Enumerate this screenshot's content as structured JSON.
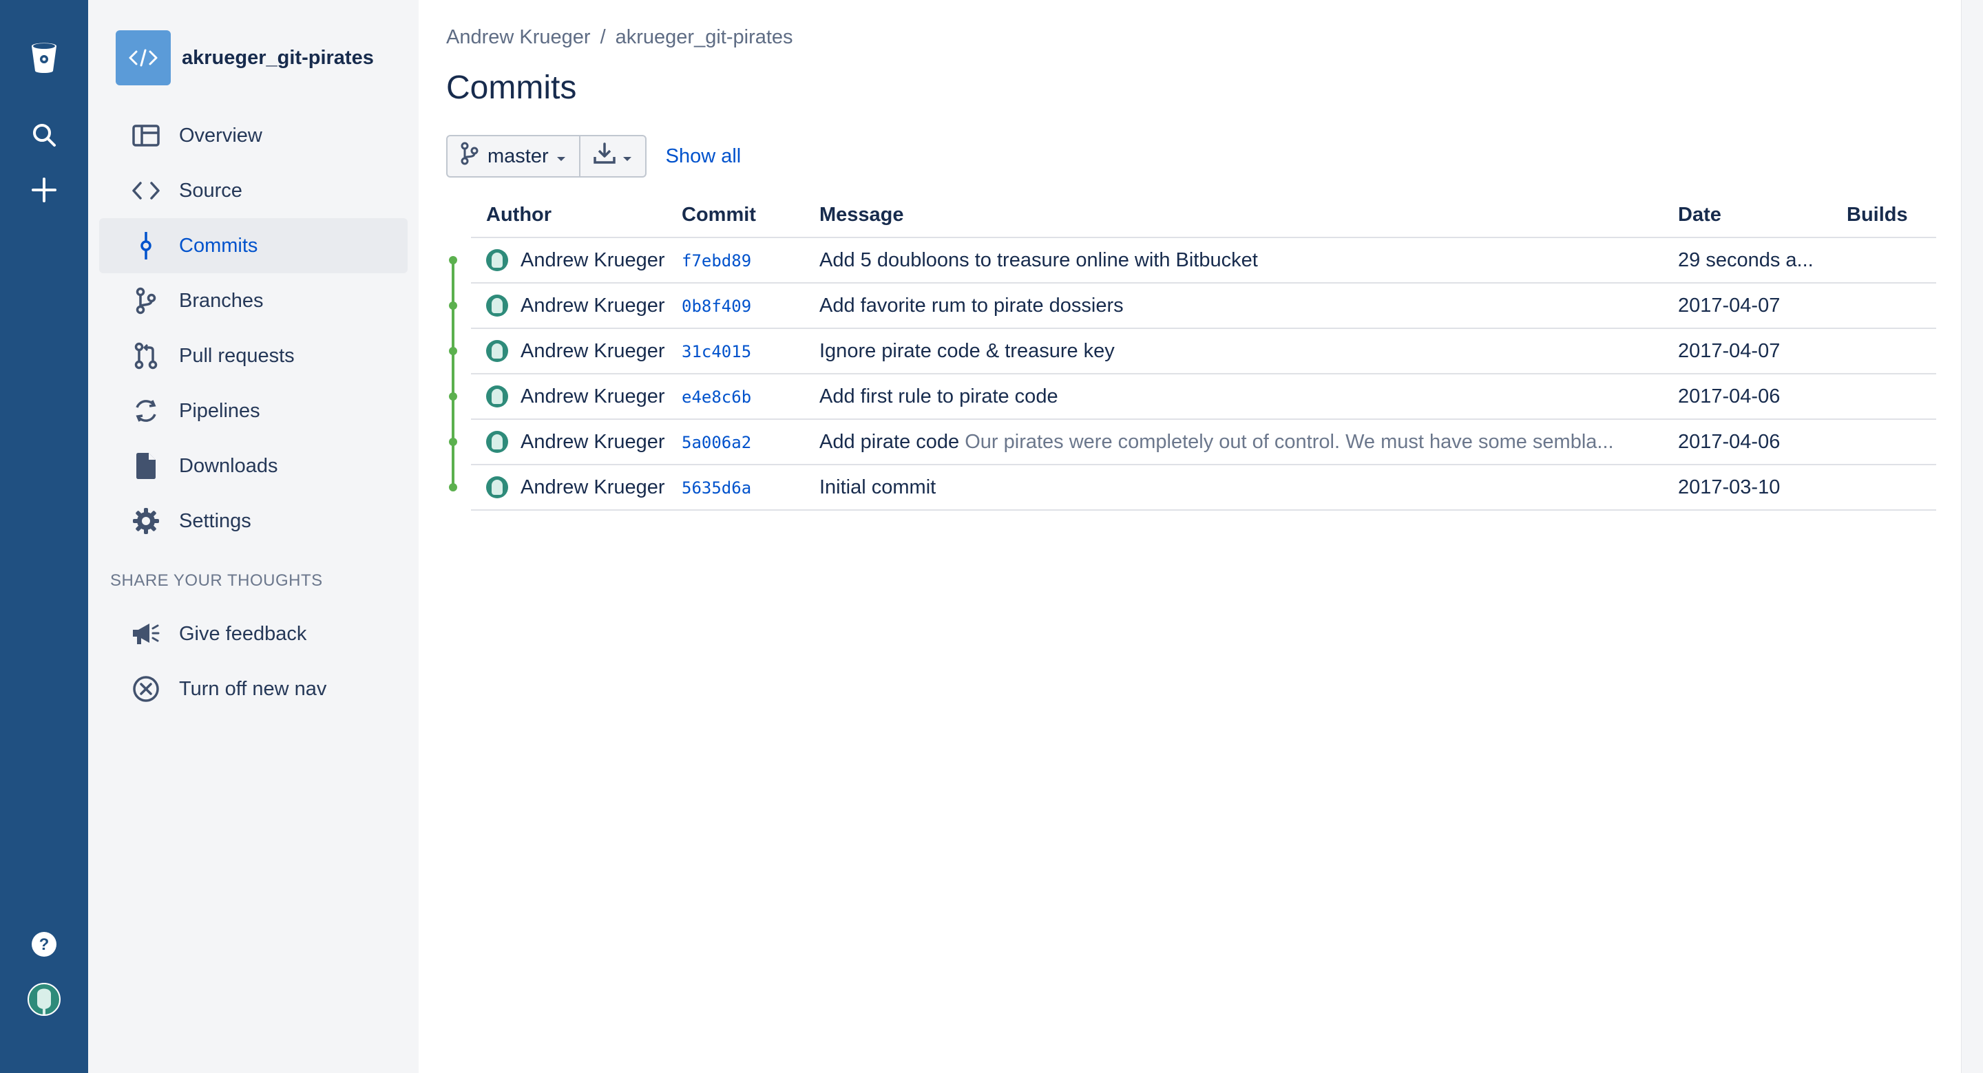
{
  "repo": {
    "name": "akrueger_git-pirates"
  },
  "sidebar": {
    "items": [
      {
        "label": "Overview",
        "icon": "overview-icon"
      },
      {
        "label": "Source",
        "icon": "code-icon"
      },
      {
        "label": "Commits",
        "icon": "commit-icon",
        "active": true
      },
      {
        "label": "Branches",
        "icon": "branch-icon"
      },
      {
        "label": "Pull requests",
        "icon": "pull-request-icon"
      },
      {
        "label": "Pipelines",
        "icon": "pipelines-icon"
      },
      {
        "label": "Downloads",
        "icon": "file-icon"
      },
      {
        "label": "Settings",
        "icon": "gear-icon"
      }
    ],
    "section_title": "SHARE YOUR THOUGHTS",
    "section_items": [
      {
        "label": "Give feedback",
        "icon": "megaphone-icon"
      },
      {
        "label": "Turn off new nav",
        "icon": "close-circle-icon"
      }
    ]
  },
  "breadcrumb": {
    "owner": "Andrew Krueger",
    "separator": "/",
    "repo": "akrueger_git-pirates"
  },
  "page": {
    "title": "Commits"
  },
  "toolbar": {
    "branch": "master",
    "show_all": "Show all"
  },
  "table": {
    "headers": {
      "author": "Author",
      "commit": "Commit",
      "message": "Message",
      "date": "Date",
      "builds": "Builds"
    },
    "rows": [
      {
        "author": "Andrew Krueger",
        "hash": "f7ebd89",
        "message": "Add 5 doubloons to treasure online with Bitbucket",
        "detail": "",
        "date": "29 seconds a..."
      },
      {
        "author": "Andrew Krueger",
        "hash": "0b8f409",
        "message": "Add favorite rum to pirate dossiers",
        "detail": "",
        "date": "2017-04-07"
      },
      {
        "author": "Andrew Krueger",
        "hash": "31c4015",
        "message": "Ignore pirate code & treasure key",
        "detail": "",
        "date": "2017-04-07"
      },
      {
        "author": "Andrew Krueger",
        "hash": "e4e8c6b",
        "message": "Add first rule to pirate code",
        "detail": "",
        "date": "2017-04-06"
      },
      {
        "author": "Andrew Krueger",
        "hash": "5a006a2",
        "message": "Add pirate code",
        "detail": "Our pirates were completely out of control. We must have some sembla...",
        "date": "2017-04-06"
      },
      {
        "author": "Andrew Krueger",
        "hash": "5635d6a",
        "message": "Initial commit",
        "detail": "",
        "date": "2017-03-10"
      }
    ]
  },
  "colors": {
    "global_nav": "#205081",
    "link": "#0052cc",
    "graph": "#5bb04e"
  }
}
